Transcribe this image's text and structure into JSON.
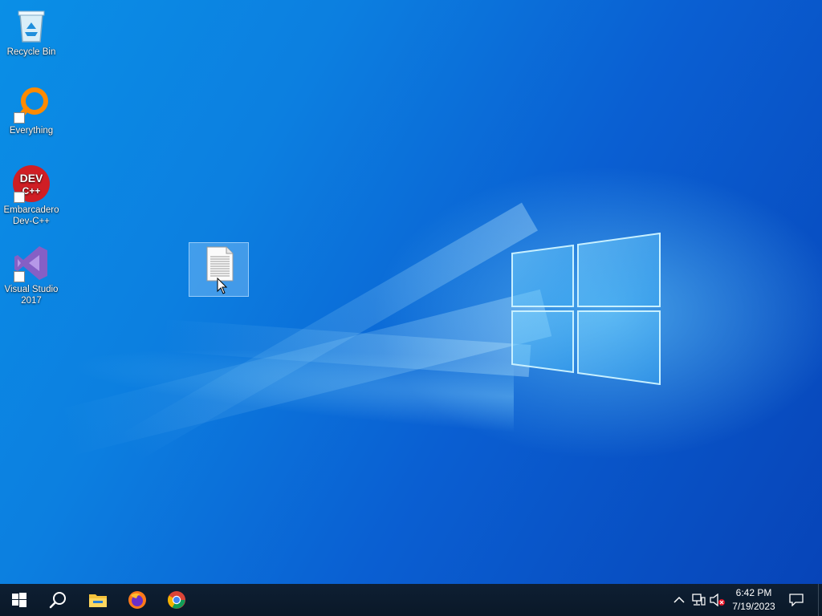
{
  "desktop": {
    "icons": [
      {
        "label": "Recycle Bin",
        "icon": "recycle-bin-icon"
      },
      {
        "label": "Everything",
        "icon": "everything-search-icon"
      },
      {
        "label": "Embarcadero Dev-C++",
        "icon": "dev-cpp-icon",
        "icon_text_1": "DEV",
        "icon_text_2": "C++"
      },
      {
        "label": "Visual Studio 2017",
        "icon": "visual-studio-icon"
      }
    ],
    "selected_file": {
      "icon": "text-document-icon",
      "label": ""
    }
  },
  "taskbar": {
    "pinned": [
      {
        "name": "start-button",
        "icon": "windows-logo-icon"
      },
      {
        "name": "search-button",
        "icon": "search-icon"
      },
      {
        "name": "file-explorer-button",
        "icon": "folder-icon"
      },
      {
        "name": "firefox-button",
        "icon": "firefox-icon"
      },
      {
        "name": "chrome-button",
        "icon": "chrome-icon"
      }
    ],
    "tray": {
      "time": "6:42 PM",
      "date": "7/19/2023",
      "icons": [
        "chevron-up-icon",
        "network-icon",
        "volume-muted-icon",
        "notification-icon"
      ]
    }
  },
  "colors": {
    "wallpaper_top": "#0a8fe6",
    "wallpaper_bottom": "#0744b8",
    "taskbar": "#0a1828",
    "selection": "#aad7ff"
  }
}
